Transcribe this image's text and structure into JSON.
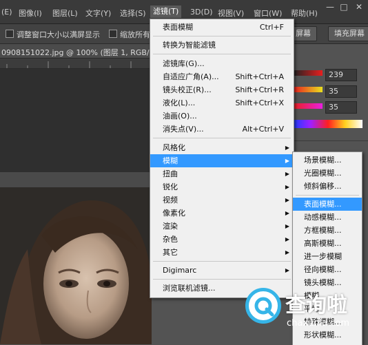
{
  "menubar": {
    "items": [
      "(E)",
      "图像(I)",
      "图层(L)",
      "文字(Y)",
      "选择(S)",
      "滤镜(T)",
      "3D(D)",
      "视图(V)",
      "窗口(W)",
      "帮助(H)"
    ],
    "window_buttons": [
      "—",
      "□",
      "✕"
    ]
  },
  "optionsbar": {
    "chk1_label": "调整窗口大小以满屏显示",
    "chk2_label": "缩放所有",
    "btn_fill_screen": "屏幕",
    "btn_fill_screen2": "填充屏幕"
  },
  "document": {
    "tab_title": "0908151022.jpg @ 100% (图层 1, RGB/8#) *"
  },
  "color_panel": {
    "values": [
      "239",
      "35",
      "35"
    ],
    "accent_red": "#e91f1f"
  },
  "filter_menu": {
    "top_item": "表面模糊",
    "top_shortcut": "Ctrl+F",
    "convert_smart": "转换为智能滤镜",
    "gallery": "滤镜库(G)...",
    "adaptive_wide": "自适应广角(A)...",
    "adaptive_wide_sc": "Shift+Ctrl+A",
    "lens_correction": "镜头校正(R)...",
    "lens_correction_sc": "Shift+Ctrl+R",
    "liquify": "液化(L)...",
    "liquify_sc": "Shift+Ctrl+X",
    "oil_paint": "油画(O)...",
    "vanishing_point": "消失点(V)...",
    "vanishing_point_sc": "Alt+Ctrl+V",
    "stylize": "风格化",
    "blur": "模糊",
    "distort": "扭曲",
    "sharpen": "锐化",
    "video": "视频",
    "pixelate": "像素化",
    "render": "渲染",
    "noise": "杂色",
    "other": "其它",
    "digimarc": "Digimarc",
    "browse_online": "浏览联机滤镜..."
  },
  "blur_submenu": {
    "items": [
      "场景模糊...",
      "光圈模糊...",
      "倾斜偏移...",
      "表面模糊...",
      "动感模糊...",
      "方框模糊...",
      "高斯模糊...",
      "进一步模糊",
      "径向模糊...",
      "镜头模糊...",
      "模糊",
      "平均",
      "特殊模糊...",
      "形状模糊..."
    ]
  },
  "watermark": {
    "name": "查询啦",
    "url": "chaxunla.com",
    "brand_color": "#36b5e8"
  }
}
